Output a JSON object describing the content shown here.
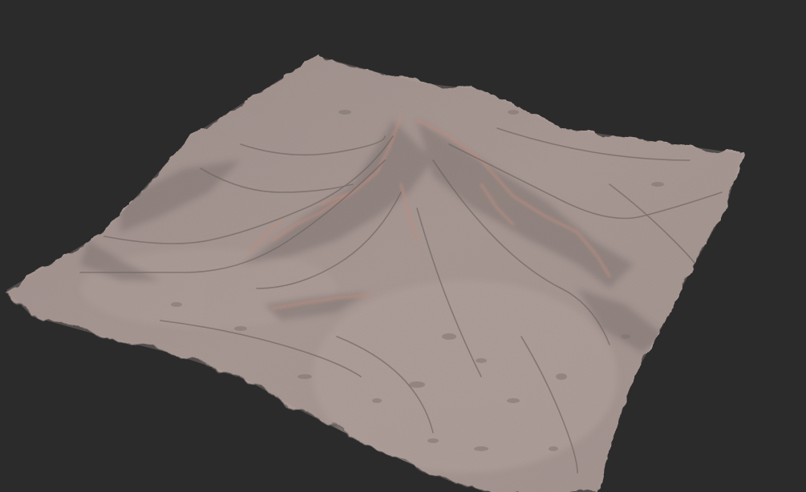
{
  "scene": {
    "background_color": "#2b2b2b",
    "subject": "terrain-heightmap-render",
    "terrain_base_color": "#a99894",
    "terrain_shadow_color": "#6f6664",
    "ridge_highlight_color": "#c98f7e",
    "valley_floor_color": "#b8a7a2"
  }
}
